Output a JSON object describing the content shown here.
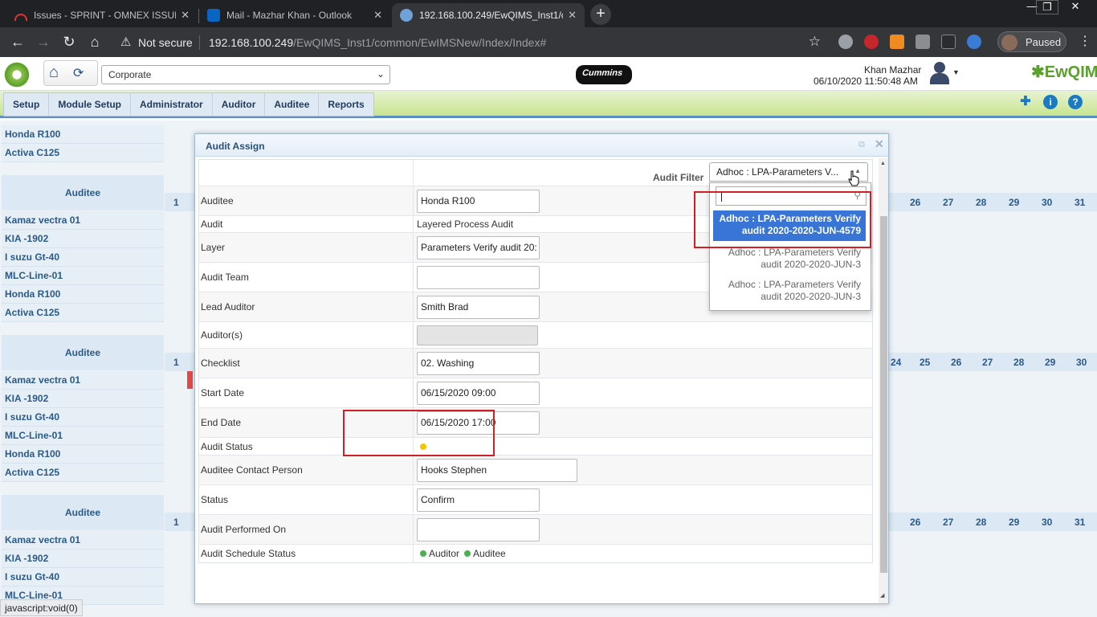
{
  "browser": {
    "tabs": [
      {
        "title": "Issues - SPRINT - OMNEX ISSUE",
        "active": false
      },
      {
        "title": "Mail - Mazhar Khan - Outlook",
        "active": false
      },
      {
        "title": "192.168.100.249/EwQIMS_Inst1/c",
        "active": true
      }
    ],
    "address_not_secure": "Not secure",
    "address_host": "192.168.100.249",
    "address_path": "/EwQIMS_Inst1/common/EwIMSNew/Index/Index#",
    "profile_label": "Paused",
    "window_min": "—",
    "window_max": "❐",
    "window_close": "✕"
  },
  "app": {
    "company_select": "Corporate",
    "brand_logo": "Cummins",
    "user_name": "Khan Mazhar",
    "user_datetime": "06/10/2020 11:50:48 AM",
    "product_logo": "EwQIMS",
    "menu": [
      "Setup",
      "Module Setup",
      "Administrator",
      "Auditor",
      "Auditee",
      "Reports"
    ],
    "menu_icons": [
      "pin-icon",
      "info-icon",
      "help-icon"
    ]
  },
  "background": {
    "auditee_header": "Auditee",
    "top_rows": [
      "Honda R100",
      "Activa C125"
    ],
    "group1_rows": [
      "Kamaz vectra 01",
      "KIA -1902",
      "I suzu Gt-40",
      "MLC-Line-01",
      "Honda R100",
      "Activa C125"
    ],
    "group2_rows": [
      "Kamaz vectra 01",
      "KIA -1902",
      "I suzu Gt-40",
      "MLC-Line-01",
      "Honda R100",
      "Activa C125"
    ],
    "group3_rows": [
      "Kamaz vectra 01",
      "KIA -1902",
      "I suzu Gt-40",
      "MLC-Line-01"
    ],
    "day_first": "1",
    "days_band1": [
      "26",
      "27",
      "28",
      "29",
      "30",
      "31"
    ],
    "days_band2": [
      "24",
      "25",
      "26",
      "27",
      "28",
      "29",
      "30"
    ],
    "days_band3": [
      "26",
      "27",
      "28",
      "29",
      "30",
      "31"
    ]
  },
  "dialog": {
    "title": "Audit Assign",
    "filter_label": "Audit Filter",
    "filter_value": "Adhoc : LPA-Parameters V...",
    "fields": {
      "auditee_label": "Auditee",
      "auditee_value": "Honda R100",
      "audit_label": "Audit",
      "audit_value": "Layered Process Audit",
      "layer_label": "Layer",
      "layer_value": "Parameters Verify audit 20:",
      "team_label": "Audit Team",
      "team_value": "",
      "lead_label": "Lead Auditor",
      "lead_value": "Smith Brad",
      "auditors_label": "Auditor(s)",
      "checklist_label": "Checklist",
      "checklist_value": "02. Washing",
      "start_label": "Start Date",
      "start_value": "06/15/2020 09:00",
      "end_label": "End Date",
      "end_value": "06/15/2020 17:00",
      "status_label": "Audit Status",
      "contact_label": "Auditee Contact Person",
      "contact_value": "Hooks Stephen",
      "state_label": "Status",
      "state_value": "Confirm",
      "performed_label": "Audit Performed On",
      "performed_value": "",
      "schedule_label": "Audit Schedule Status",
      "schedule_auditor": "Auditor",
      "schedule_auditee": "Auditee"
    },
    "colors": {
      "status_dot": "#f2c500",
      "schedule_dot": "#4caf50",
      "highlight": "#d21f26"
    }
  },
  "dropdown": {
    "options": [
      {
        "line1": "Adhoc : LPA-Parameters Verify",
        "line2": "audit 2020-2020-JUN-4579",
        "selected": true
      },
      {
        "line1": "Adhoc : LPA-Parameters Verify",
        "line2": "audit 2020-2020-JUN-3",
        "selected": false
      },
      {
        "line1": "Adhoc : LPA-Parameters Verify",
        "line2": "audit 2020-2020-JUN-3",
        "selected": false
      }
    ]
  },
  "status_bar": "javascript:void(0)"
}
